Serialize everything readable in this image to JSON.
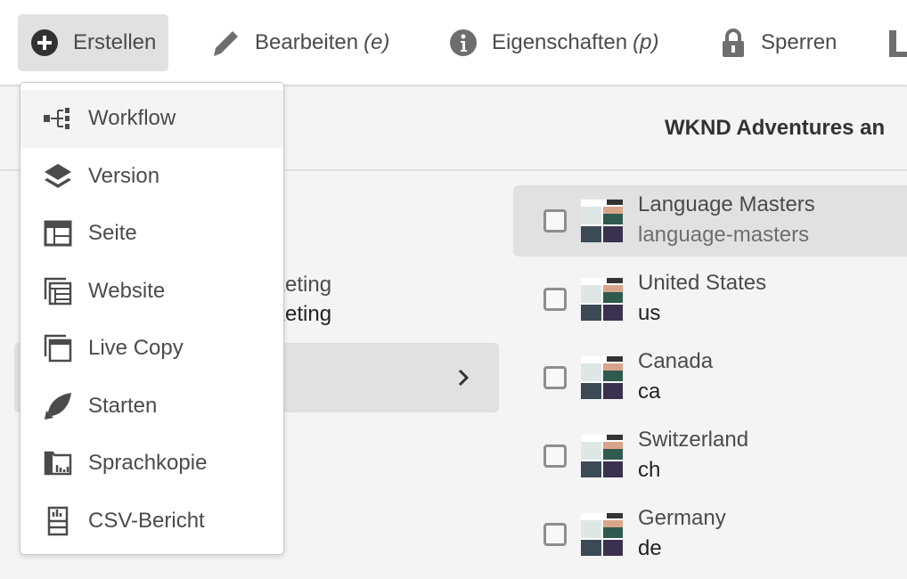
{
  "toolbar": {
    "create": "Erstellen",
    "edit": "Bearbeiten",
    "edit_key": "(e)",
    "properties": "Eigenschaften",
    "properties_key": "(p)",
    "lock": "Sperren"
  },
  "header": {
    "title": "WKND Adventures an"
  },
  "left_column": {
    "item_title": "rketing",
    "item_subtitle": "rketing"
  },
  "list": [
    {
      "title": "Language Masters",
      "name": "language-masters",
      "selected": true
    },
    {
      "title": "United States",
      "name": "us"
    },
    {
      "title": "Canada",
      "name": "ca"
    },
    {
      "title": "Switzerland",
      "name": "ch"
    },
    {
      "title": "Germany",
      "name": "de"
    }
  ],
  "create_menu": [
    {
      "label": "Workflow",
      "icon": "workflow-icon"
    },
    {
      "label": "Version",
      "icon": "layers-icon"
    },
    {
      "label": "Seite",
      "icon": "page-icon"
    },
    {
      "label": "Website",
      "icon": "website-icon"
    },
    {
      "label": "Live Copy",
      "icon": "live-copy-icon"
    },
    {
      "label": "Starten",
      "icon": "launch-icon"
    },
    {
      "label": "Sprachkopie",
      "icon": "language-copy-icon"
    },
    {
      "label": "CSV-Bericht",
      "icon": "csv-report-icon"
    }
  ]
}
